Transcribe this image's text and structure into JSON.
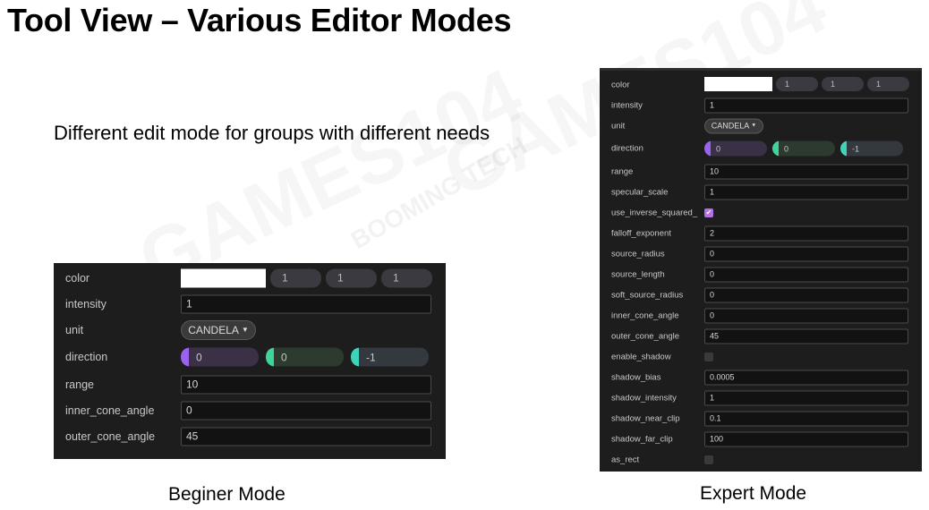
{
  "slide": {
    "title": "Tool View – Various Editor Modes",
    "subtitle": "Different edit mode for groups with different needs",
    "beginner_caption": "Beginer Mode",
    "expert_caption": "Expert Mode",
    "watermark_main": "GAMES104",
    "watermark_brand": "BOOMING TECH"
  },
  "colors": {
    "panel_bg": "#1d1d1d",
    "field_bg": "#121212",
    "x_axis": "#9a62ee",
    "y_axis": "#3ed49a",
    "z_axis": "#3ed4ba",
    "checkbox_on": "#b271e6"
  },
  "beginner": {
    "color": {
      "label": "color",
      "r": "1",
      "g": "1",
      "b": "1"
    },
    "intensity": {
      "label": "intensity",
      "value": "1"
    },
    "unit": {
      "label": "unit",
      "value": "CANDELA",
      "icon": "caret-down-icon"
    },
    "direction": {
      "label": "direction",
      "x": "0",
      "y": "0",
      "z": "-1"
    },
    "range": {
      "label": "range",
      "value": "10"
    },
    "inner_cone_angle": {
      "label": "inner_cone_angle",
      "value": "0"
    },
    "outer_cone_angle": {
      "label": "outer_cone_angle",
      "value": "45"
    }
  },
  "expert": {
    "color": {
      "label": "color",
      "r": "1",
      "g": "1",
      "b": "1"
    },
    "intensity": {
      "label": "intensity",
      "value": "1"
    },
    "unit": {
      "label": "unit",
      "value": "CANDELA",
      "icon": "caret-down-icon"
    },
    "direction": {
      "label": "direction",
      "x": "0",
      "y": "0",
      "z": "-1"
    },
    "range": {
      "label": "range",
      "value": "10"
    },
    "specular_scale": {
      "label": "specular_scale",
      "value": "1"
    },
    "use_inverse_squared": {
      "label": "use_inverse_squared_",
      "checked": true
    },
    "falloff_exponent": {
      "label": "falloff_exponent",
      "value": "2"
    },
    "source_radius": {
      "label": "source_radius",
      "value": "0"
    },
    "source_length": {
      "label": "source_length",
      "value": "0"
    },
    "soft_source_radius": {
      "label": "soft_source_radius",
      "value": "0"
    },
    "inner_cone_angle": {
      "label": "inner_cone_angle",
      "value": "0"
    },
    "outer_cone_angle": {
      "label": "outer_cone_angle",
      "value": "45"
    },
    "enable_shadow": {
      "label": "enable_shadow",
      "checked": false
    },
    "shadow_bias": {
      "label": "shadow_bias",
      "value": "0.0005"
    },
    "shadow_intensity": {
      "label": "shadow_intensity",
      "value": "1"
    },
    "shadow_near_clip": {
      "label": "shadow_near_clip",
      "value": "0.1"
    },
    "shadow_far_clip": {
      "label": "shadow_far_clip",
      "value": "100"
    },
    "as_rect": {
      "label": "as_rect",
      "checked": false
    }
  }
}
